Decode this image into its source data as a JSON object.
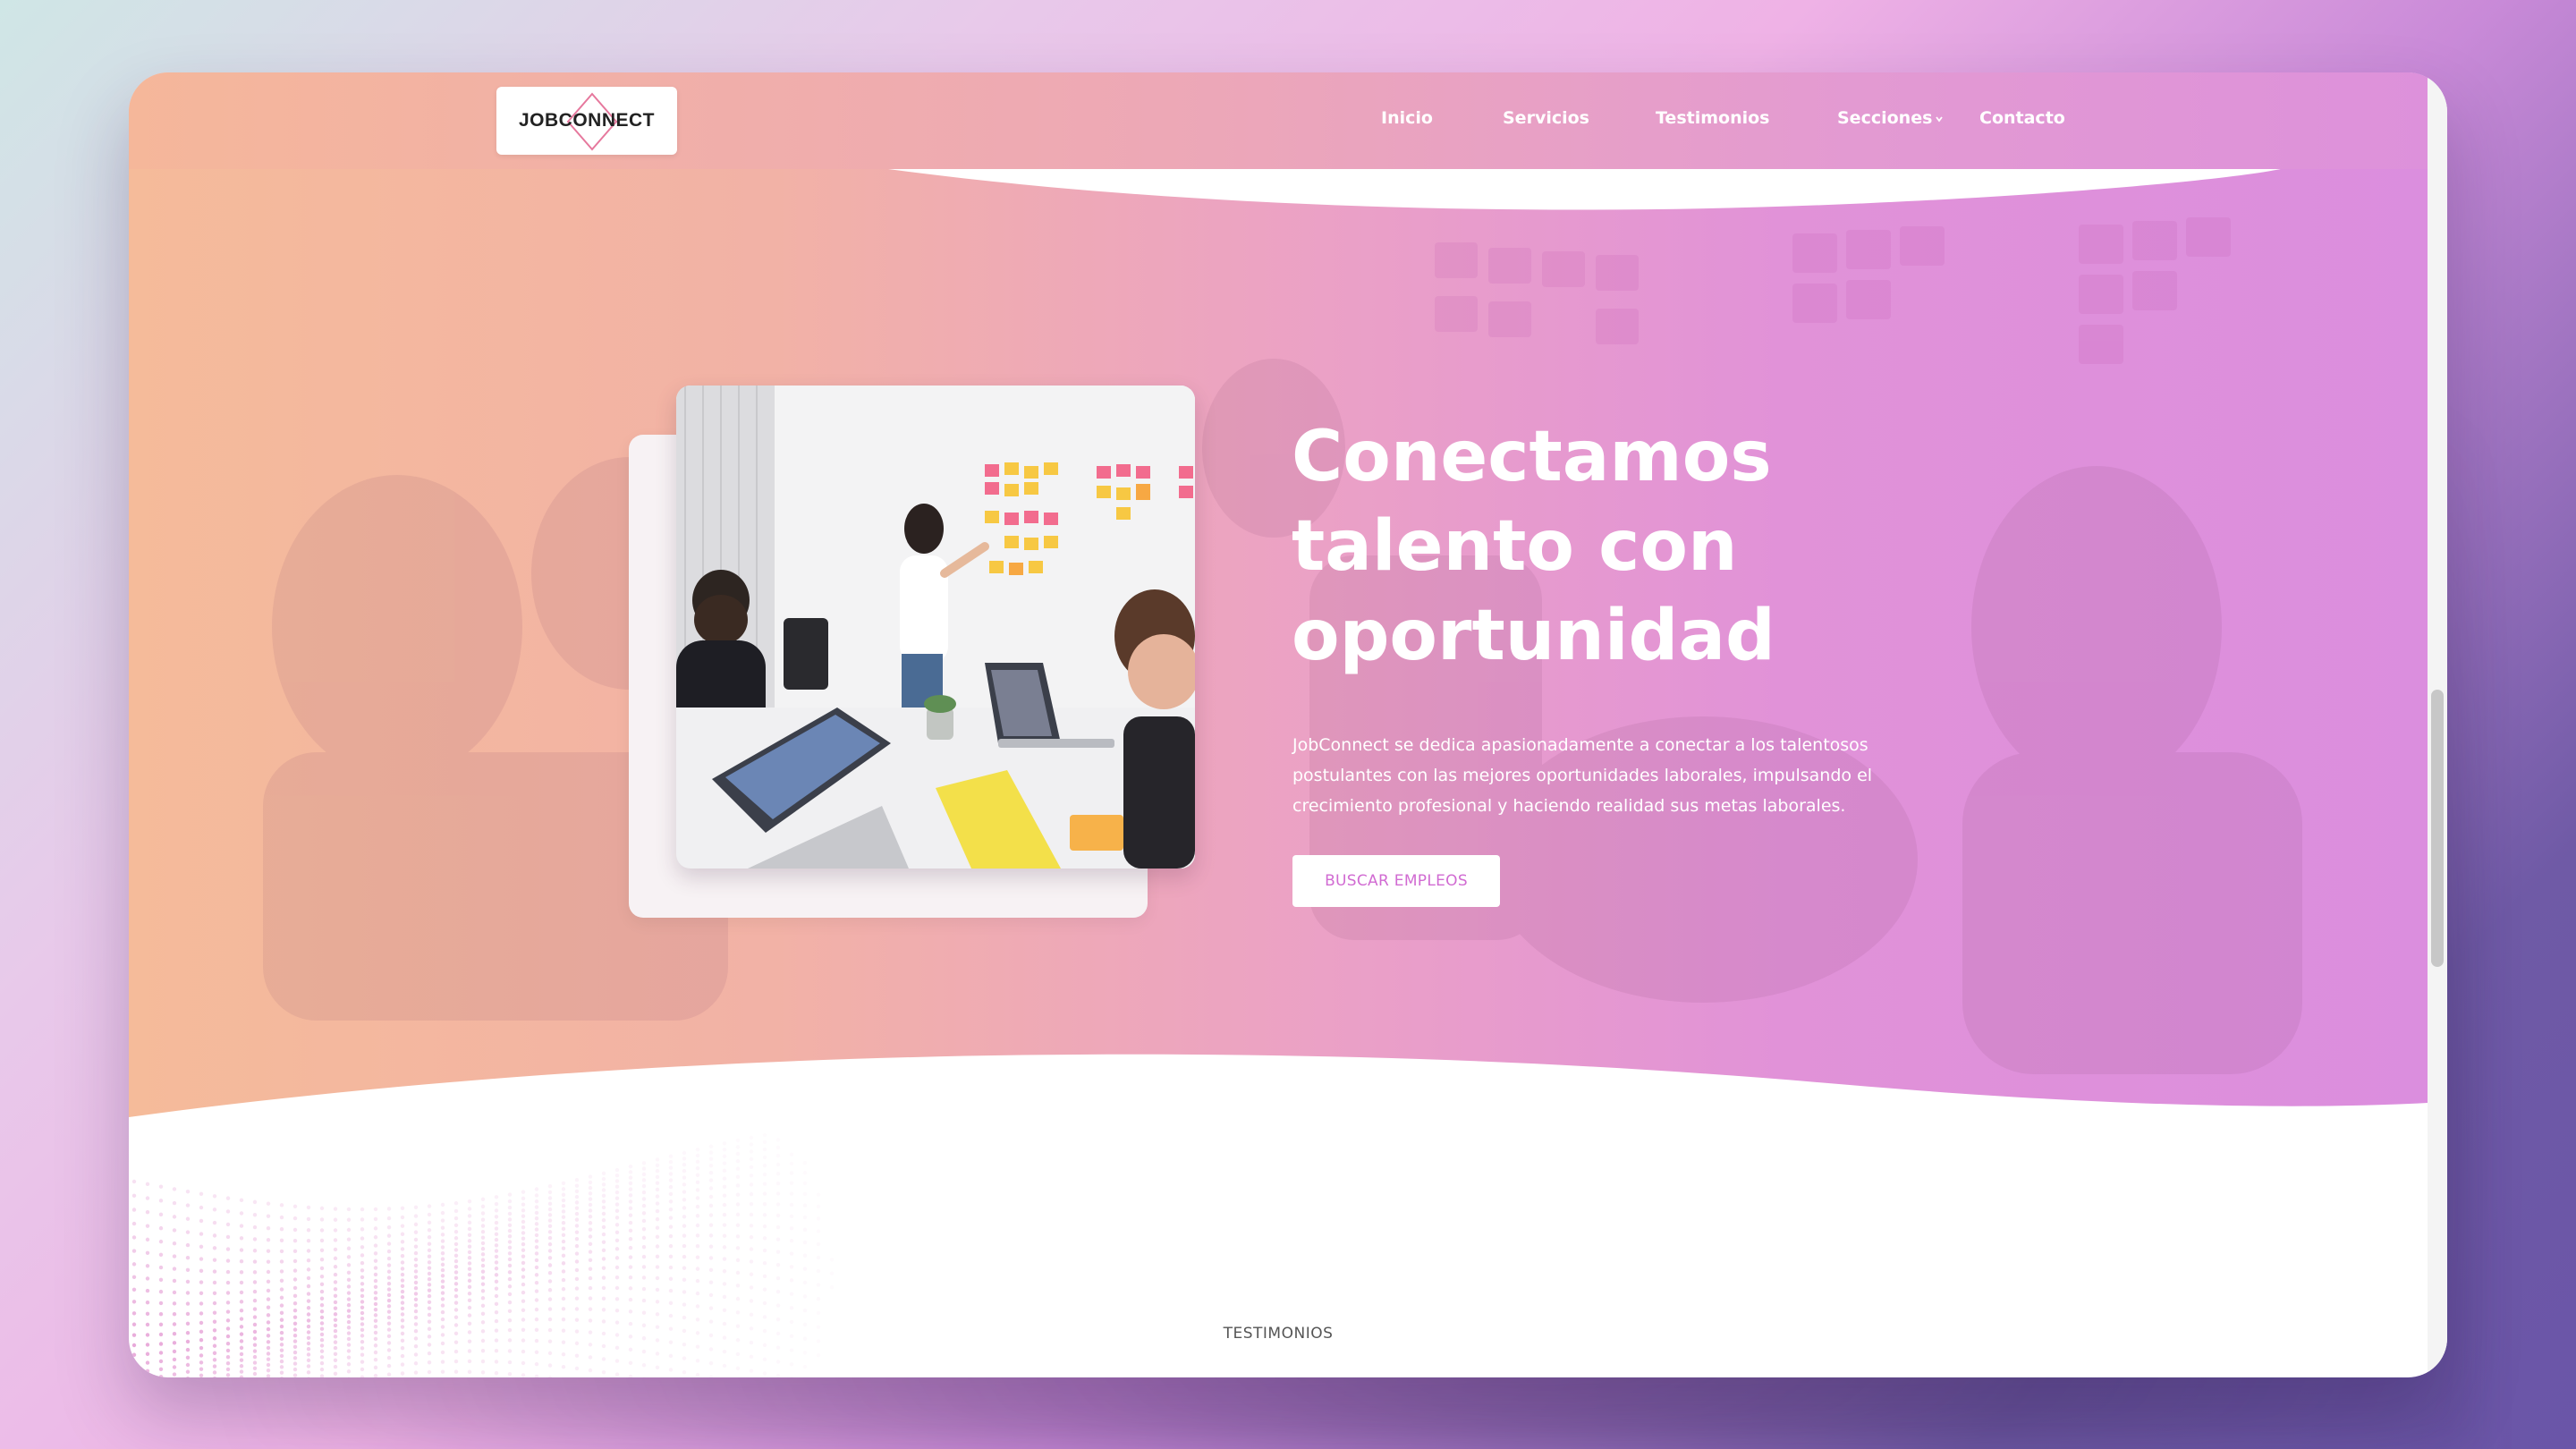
{
  "brand": {
    "name": "JOBCONNECT",
    "logo_icon": "diamond-outline-icon"
  },
  "nav": {
    "items": [
      {
        "label": "Inicio"
      },
      {
        "label": "Servicios"
      },
      {
        "label": "Testimonios"
      },
      {
        "label": "Secciones",
        "icon": "chevron-down-icon"
      },
      {
        "label": "Contacto"
      }
    ]
  },
  "hero": {
    "headline_lines": [
      "Conectamos",
      "talento con",
      "oportunidad"
    ],
    "description": "JobConnect se dedica apasionadamente a conectar a los talentosos postulantes con las mejores oportunidades laborales, impulsando el crecimiento profesional y haciendo realidad sus metas laborales.",
    "cta_label": "BUSCAR EMPLEOS",
    "image": "office-team-meeting-photo"
  },
  "testimonials": {
    "label": "TESTIMONIOS"
  },
  "colors": {
    "hero_gradient_start": "#f5bb9a",
    "hero_gradient_end": "#db8ede",
    "accent": "#d16bd2",
    "white": "#ffffff"
  }
}
